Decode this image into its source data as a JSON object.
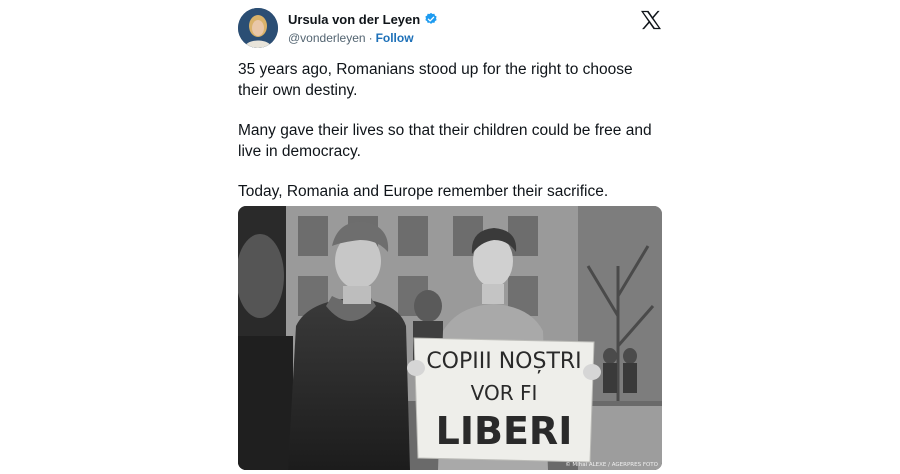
{
  "author": {
    "name": "Ursula von der Leyen",
    "handle": "@vonderleyen",
    "separator": "·",
    "follow_label": "Follow"
  },
  "icons": {
    "verified": "verified-badge-icon",
    "platform": "x-logo-icon"
  },
  "tweet": {
    "paragraphs": [
      "35 years ago, Romanians stood up for the right to choose their own destiny.",
      "Many gave their lives so that their children could be free and live in democracy.",
      "Today, Romania and Europe remember their sacrifice."
    ]
  },
  "photo": {
    "sign_lines": [
      "COPIII NOȘTRI",
      "VOR FI",
      "LIBERI"
    ],
    "credit": "© Mihai ALEXE / AGERPRES FOTO"
  },
  "colors": {
    "verified_badge": "#1d9bf0",
    "follow_link": "#1d70b8",
    "text": "#0f1419",
    "secondary_text": "#536471"
  }
}
